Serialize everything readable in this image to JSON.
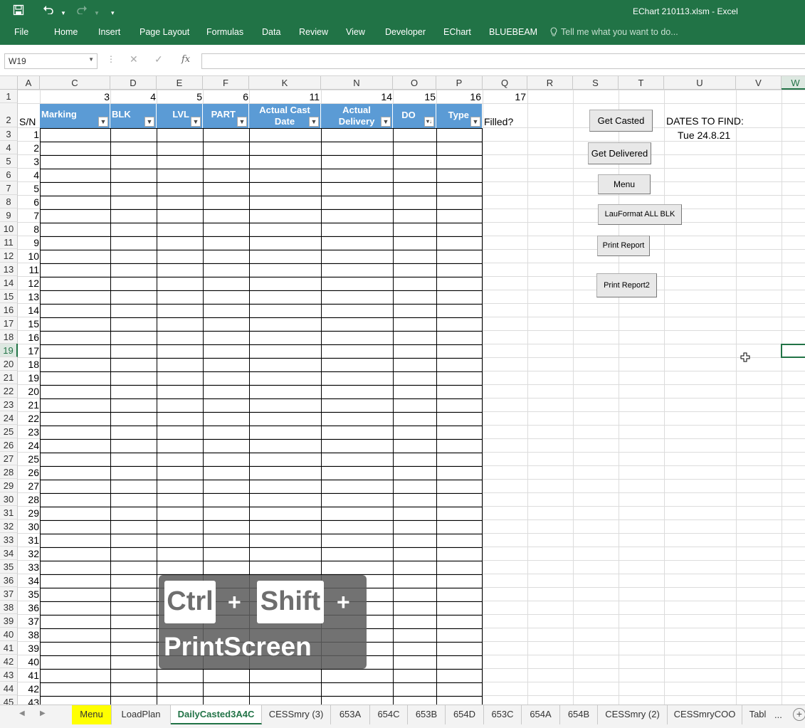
{
  "window": {
    "title": "EChart 210113.xlsm - Excel"
  },
  "qat": {
    "save_icon": "save-icon",
    "undo_icon": "undo-icon",
    "redo_icon": "redo-icon",
    "customize_icon": "customize-icon"
  },
  "ribbon": {
    "tabs": [
      "File",
      "Home",
      "Insert",
      "Page Layout",
      "Formulas",
      "Data",
      "Review",
      "View",
      "Developer",
      "EChart",
      "BLUEBEAM"
    ],
    "tell_me": "Tell me what you want to do..."
  },
  "formula_bar": {
    "name_box": "W19",
    "fx": "fx",
    "value": ""
  },
  "columns": [
    "A",
    "C",
    "D",
    "E",
    "F",
    "K",
    "N",
    "O",
    "P",
    "Q",
    "R",
    "S",
    "T",
    "U",
    "V",
    "W"
  ],
  "rows": [
    "1",
    "2",
    "3",
    "4",
    "5",
    "6",
    "7",
    "8",
    "9",
    "10",
    "11",
    "12",
    "13",
    "14",
    "15",
    "16",
    "17",
    "18",
    "19",
    "20",
    "21",
    "22",
    "23",
    "24",
    "25",
    "26",
    "27",
    "28",
    "29",
    "30",
    "31",
    "32",
    "33",
    "34",
    "35",
    "36",
    "37",
    "38",
    "39",
    "40",
    "41",
    "42",
    "43",
    "44",
    "45"
  ],
  "row1_numbers": [
    "3",
    "4",
    "5",
    "6",
    "11",
    "14",
    "15",
    "16",
    "17"
  ],
  "table": {
    "sn_label": "S/N",
    "headers": [
      "Marking",
      "BLK",
      "LVL",
      "PART",
      "Actual Cast Date",
      "Actual Delivery",
      "DO",
      "Type"
    ],
    "filled_label": "Filled?",
    "serials": [
      "1",
      "2",
      "3",
      "4",
      "5",
      "6",
      "7",
      "8",
      "9",
      "10",
      "11",
      "12",
      "13",
      "14",
      "15",
      "16",
      "17",
      "18",
      "19",
      "20",
      "21",
      "22",
      "23",
      "24",
      "25",
      "26",
      "27",
      "28",
      "29",
      "30",
      "31",
      "32",
      "33",
      "34",
      "35",
      "36",
      "37",
      "38",
      "39",
      "40",
      "41",
      "42",
      "43"
    ]
  },
  "side": {
    "dates_label": "DATES TO FIND:",
    "date_value": "Tue 24.8.21"
  },
  "buttons": {
    "get_casted": "Get Casted",
    "get_delivered": "Get Delivered",
    "menu": "Menu",
    "lauformat": "LauFormat ALL BLK",
    "print_report": "Print Report",
    "print_report2": "Print Report2"
  },
  "overlay": {
    "ctrl": "Ctrl",
    "plus": "+",
    "shift": "Shift",
    "printscreen": "PrintScreen"
  },
  "sheet_tabs": [
    "Menu",
    "LoadPlan",
    "DailyCasted3A4C",
    "CESSmry (3)",
    "653A",
    "654C",
    "653B",
    "654D",
    "653C",
    "654A",
    "654B",
    "CESSmry (2)",
    "CESSmryCOO",
    "Tabl"
  ],
  "tabs_more": "...",
  "add_sheet": "+",
  "colors": {
    "excel_green": "#217346",
    "table_header": "#5b9bd5",
    "menu_tab": "#ffff00"
  }
}
